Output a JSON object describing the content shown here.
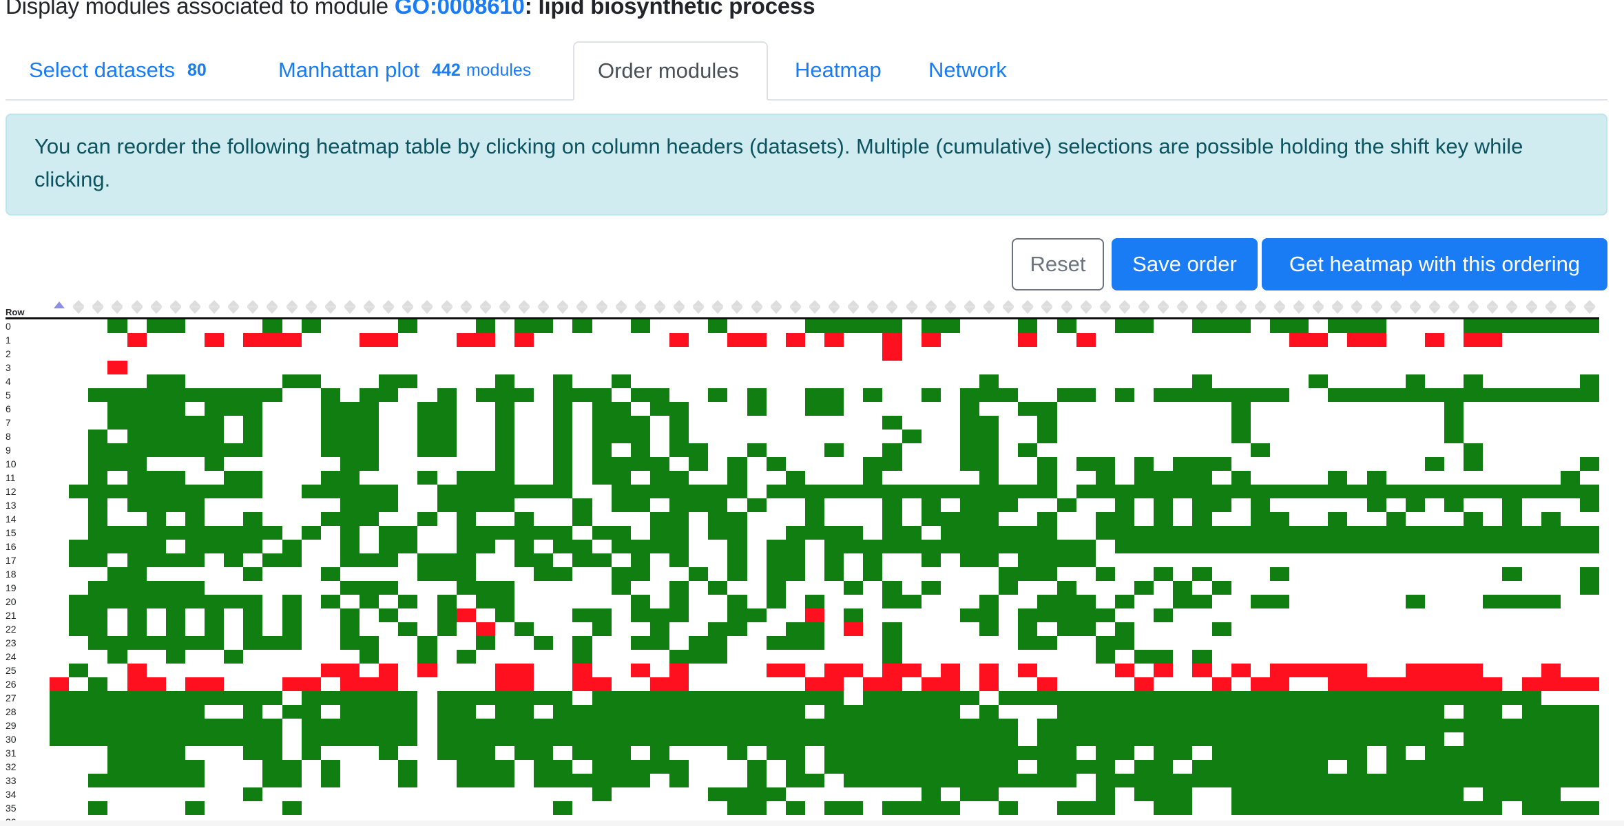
{
  "header": {
    "prefix": "Display modules associated to module ",
    "go_id": "GO:0008610",
    "term": ": lipid biosynthetic process"
  },
  "tabs": [
    {
      "label": "Select datasets",
      "count": "80",
      "suffix": ""
    },
    {
      "label": "Manhattan plot",
      "count": "442",
      "suffix": "modules"
    },
    {
      "label": "Order modules",
      "count": "",
      "suffix": "",
      "active": true
    },
    {
      "label": "Heatmap",
      "count": "",
      "suffix": ""
    },
    {
      "label": "Network",
      "count": "",
      "suffix": ""
    }
  ],
  "alert": {
    "text": "You can reorder the following heatmap table by clicking on column headers (datasets). Multiple (cumulative) selections are possible holding the shift key while clicking."
  },
  "buttons": {
    "reset": "Reset",
    "save": "Save order",
    "get_heatmap": "Get heatmap with this ordering"
  },
  "heatmap": {
    "row_header": "Row",
    "n_columns": 80,
    "sorted_column": 0,
    "sort_direction": "ascending",
    "colors": {
      "up": "#117e12",
      "down": "#fe101f",
      "none": "#ffffff"
    },
    "legend": {
      "g": "up",
      "r": "down",
      ".": "none"
    },
    "rows": [
      "...g.gg....g.g....g...g.gg.g..g...g....ggggg.gg...g.g..gg..ggg.gg.ggg....gggggggggg",
      "....r...r.rrr...rr...rr.r.......r..rr.r.r..r.r....r..r..........rr.rr..r.rr.....r.r.",
      "...........................................r.....................................",
      "...r............................................................................",
      ".....gg.....gg...gg....g..g..g..................g..........g.....g....g..g.....g.",
      "..gggggggggg..g.gg..g.ggg.ggg.gg..g.g..gg.g..g.ggg..gg.g.ggggggg..ggggggggggggggg.",
      "...gggg.ggg...ggg..gg..g..g.gg.gg...g..gg......g..gg.........g..........g........g.",
      "...gggggg.g...ggg..gg..g..g.ggg.g..........g...gg..g.........g..........g........g.",
      "..g.ggggg.g...ggg..gg..g..g.ggg.g...........g..gg..g.........g..........g........g.",
      "..ggggggggg...ggg..gg..g..g.g.g.gg..g...g..g...gg.g...........g..........g........g",
      "..ggg...g......gg......g..g.gggg.g.g.g....gg...gg..g.gg.g.ggg..........g.g.....gg.g",
      "..g.ggg..gg...gg...g.ggg..g.gg.gg..g..g...g.....g..g..g.gggg.g....g.g.........g...g",
      ".gggggggggg..ggggg..ggggggg..ggggggg.ggggggggggggggg.gggggggggggggggggggggggggggggg",
      "..g.gggg.......ggg..gggg...g.gg.ggg.g..g...g.g.ggg..g..g.g.gg.g.....g.g.g..g...g...",
      "..g..g.g..g...ggg..g.g..g..g...gg.gg...g...g.gggg..g..gg.g.g..gg..g..g...g.g.g...g.",
      "..gggggggggg.g.g.gg..gggggg.gg.gg.gg..gggg.gg.gggggg..ggggggggggggggggggggggggggggg",
      ".ggggg.gggg.g..g.gg..gg.g.gg.gggg..g.gg.gggggggggggggg.gggggggggggggggggggggggggggg",
      ".gg.gggg.g.gg..ggg.ggg..gg.gg.g.g..g.gg.g.g..g.gg.gggg..........................g.",
      "...gg.....g...g....ggg...gg..gg..g.g.gg.g.g......ggg..g..g.g...g...........g...g..g",
      "..gggggg.......ggg...ggg.....g..g.g..g...g.g.g...g..g...g.g.g..................g..",
      ".gggggggggg.g.g.g.g.g.gg......g.g..g.g.g...gg...g..ggg.g..gg..gg......g...gggg....",
      ".gg.g.g.g.g.g..g.g..gr.g...gg.ggg..gg..r.g.....gg.ggggg..g.........................",
      ".gg.g.g.g.g.g..g..g.g.r.g...g..g..gg..gg.r.g....g.g.gg.g....g.........................",
      "..ggggggg.ggg..gg..g..g..g.g..gg.gg..ggg...g......gg..gg.......................",
      "...g..g..g......g..g.g.....g....ggg........g..........g.gg.g....................",
      ".g..r.........rr.r.r...rr..r..r.r....rr.rr.rr.r.r.r....r.r.r.r.rrrrr..rrrr...r..r.",
      "r.g.rr.rr...rr.rrr.....rr..rr..rr......rr.rr.rr.r..r....r...r.rr..rrrrrrrrr.rrrrrr.r.r",
      "gggggggggggg.gggggg.ggggggg.ggggggggggggg.gggggg.gggggggggggggggggggggggggggg",
      "gggggggg..g.gg.gggg.gg.gg.ggggggggggggg.ggggggg.g...gggggggggggggggggggg.gg.ggggggg",
      "gggggggggggg.gggggg.gggggggggggggggggggggggggggggg.gggggggggggggggggggggggggggggggg",
      "gggggggggggg.gggggg.gggggggggggggggggggggggggggggg.ggggggggggggggggggggg.ggggggggggg",
      "...gggg...gg.g...g..ggg.gg.ggg.g...g.gg.ggggggggggggg.gg.gg.gggggggg.g.gggggggggg",
      "...ggggg...gg.g...g..ggg.gg.ggggg...g.g.gggggggggg.gggg.gg.ggggggg.g.ggggggggggg",
      "..gggggg...gg.g...g..ggg.gggggg.g...g.gg.gggggggggggg.gggggggggggggggggggggggggg",
      "..........g.................g.....gggg.......g.gg.....g.ggg..gggggggggggg.gggg",
      "..g....g....g.............g........gg.g.gg.gggg..g..ggg..gg..gggggggggggggg.gggg",
      "..........................................................................................."
    ]
  }
}
